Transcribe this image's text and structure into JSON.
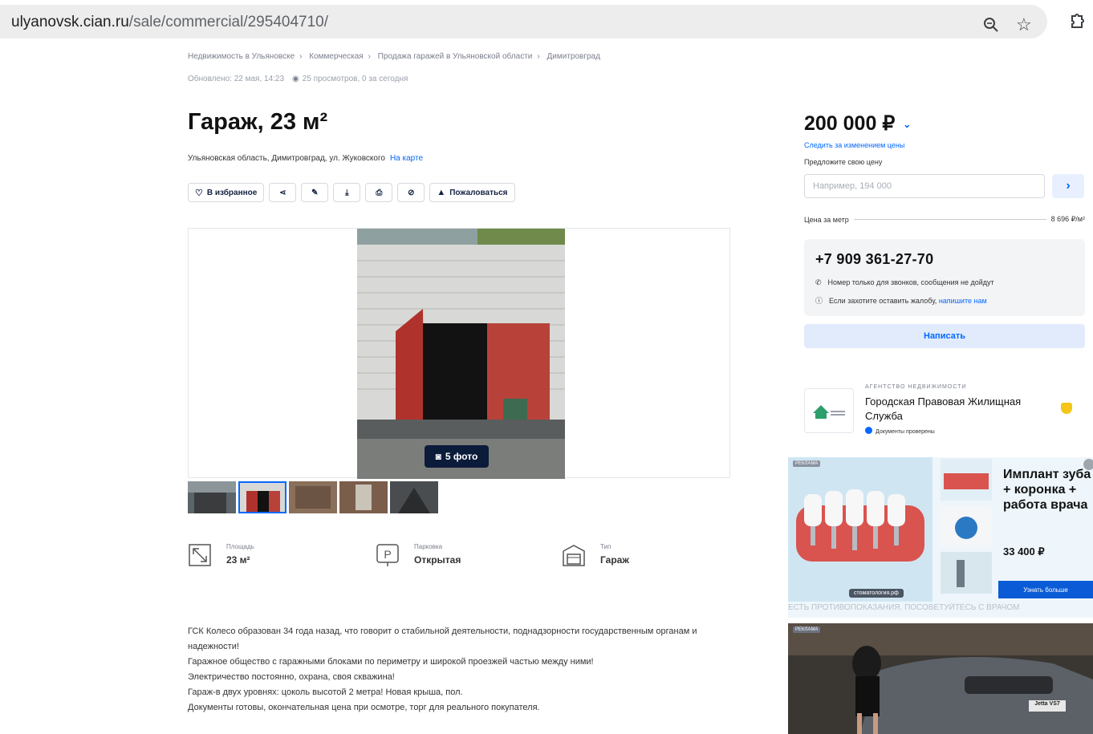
{
  "browser": {
    "url_host": "ulyanovsk.cian.ru",
    "url_path": "/sale/commercial/295404710/"
  },
  "breadcrumbs": [
    "Недвижимость в Ульяновске",
    "Коммерческая",
    "Продажа гаражей в Ульяновской области",
    "Димитровград"
  ],
  "meta": {
    "updated": "Обновлено: 22 мая, 14:23",
    "views": "25 просмотров, 0 за сегодня"
  },
  "listing": {
    "title": "Гараж, 23 м²",
    "address": "Ульяновская область, Димитровград, ул. Жуковского",
    "map_link": "На карте"
  },
  "actions": {
    "favorite": "В избранное",
    "complain": "Пожаловаться"
  },
  "gallery": {
    "photo_count": "5 фото"
  },
  "features": [
    {
      "label": "Площадь",
      "value": "23 м²"
    },
    {
      "label": "Парковка",
      "value": "Открытая"
    },
    {
      "label": "Тип",
      "value": "Гараж"
    }
  ],
  "description": [
    "ГСК Колесо образован 34 года назад, что говорит о стабильной деятельности, поднадзорности государственным органам и надежности!",
    "Гаражное общество с гаражными блоками по периметру и широкой проезжей частью между ними!",
    "Электричество  постоянно, охрана, своя скважина!",
    "Гараж-в двух уровнях: цоколь высотой 2 метра! Новая крыша, пол.",
    "Документы готовы, окончательная цена при осмотре, торг для реального покупателя."
  ],
  "sidebar": {
    "price": "200 000 ₽",
    "watch_price": "Следить за изменением цены",
    "offer_label": "Предложите свою цену",
    "offer_placeholder": "Например, 194 000",
    "price_per_meter_label": "Цена за метр",
    "price_per_meter_value": "8 696 ₽/м²",
    "phone": "+7 909 361-27-70",
    "phone_note": "Номер только для звонков, сообщения не дойдут",
    "complaint_note": "Если захотите оставить жалобу,",
    "complaint_link": "напишите нам",
    "write_button": "Написать"
  },
  "agency": {
    "kind": "АГЕНТСТВО НЕДВИЖИМОСТИ",
    "name": "Городская Правовая Жилищная Служба",
    "verified": "Документы проверены"
  },
  "ads": {
    "label": "РЕКЛАМА",
    "dental_text": "Имплант зуба + коронка + работа врача",
    "dental_price": "33 400 ₽",
    "dental_button": "Узнать больше",
    "dental_site": "стоматология.рф",
    "dental_warning": "ЕСТЬ ПРОТИВОПОКАЗАНИЯ. ПОСОВЕТУЙТЕСЬ С ВРАЧОМ",
    "car_plate": "Jetta VS7"
  },
  "colors": {
    "accent": "#0468ff",
    "text": "#121212"
  }
}
